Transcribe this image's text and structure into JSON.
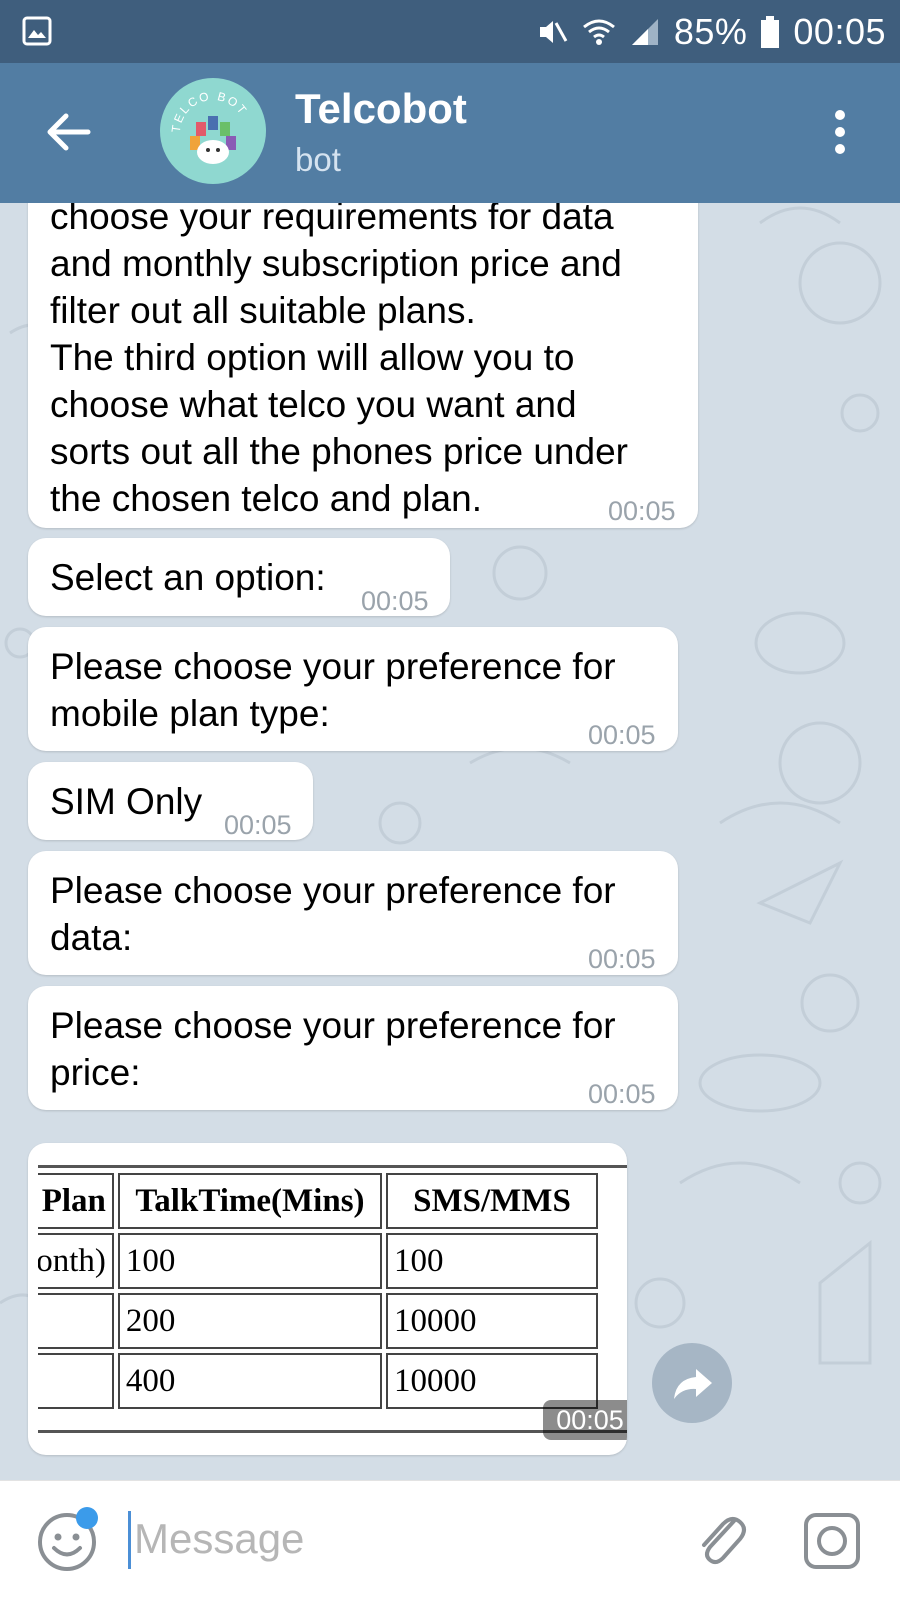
{
  "status_bar": {
    "battery": "85%",
    "time": "00:05",
    "icons": [
      "gallery-icon",
      "mute-icon",
      "wifi-icon",
      "signal-icon",
      "battery-icon"
    ]
  },
  "header": {
    "title": "Telcobot",
    "subtitle": "bot",
    "avatar_text": "TELCO BOT",
    "icons": [
      "back-arrow-icon",
      "more-vert-icon"
    ],
    "color": "#527da3"
  },
  "messages": [
    {
      "lines": [
        "choose your requirements for data",
        "and monthly subscription price and",
        "filter out all suitable plans.",
        "The third option will allow you to",
        "choose what telco you want and",
        "sorts out all the phones price under",
        "the chosen telco and plan."
      ],
      "time": "00:05"
    },
    {
      "lines": [
        "Select an option:"
      ],
      "time": "00:05"
    },
    {
      "lines": [
        "Please choose your preference for",
        "mobile plan type:"
      ],
      "time": "00:05"
    },
    {
      "lines": [
        "SIM Only"
      ],
      "time": "00:05"
    },
    {
      "lines": [
        "Please choose your preference for",
        "data:"
      ],
      "time": "00:05"
    },
    {
      "lines": [
        "Please choose your preference for",
        "price:"
      ],
      "time": "00:05"
    }
  ],
  "table_image": {
    "headers": [
      "Plan",
      "TalkTime(Mins)",
      "SMS/MMS"
    ],
    "rows": [
      [
        "month)",
        "100",
        "100"
      ],
      [
        "",
        "200",
        "10000"
      ],
      [
        "",
        "400",
        "10000"
      ]
    ],
    "time": "00:05"
  },
  "input": {
    "placeholder": "Message",
    "icons": [
      "emoji-icon",
      "attach-icon",
      "camera-icon"
    ]
  }
}
